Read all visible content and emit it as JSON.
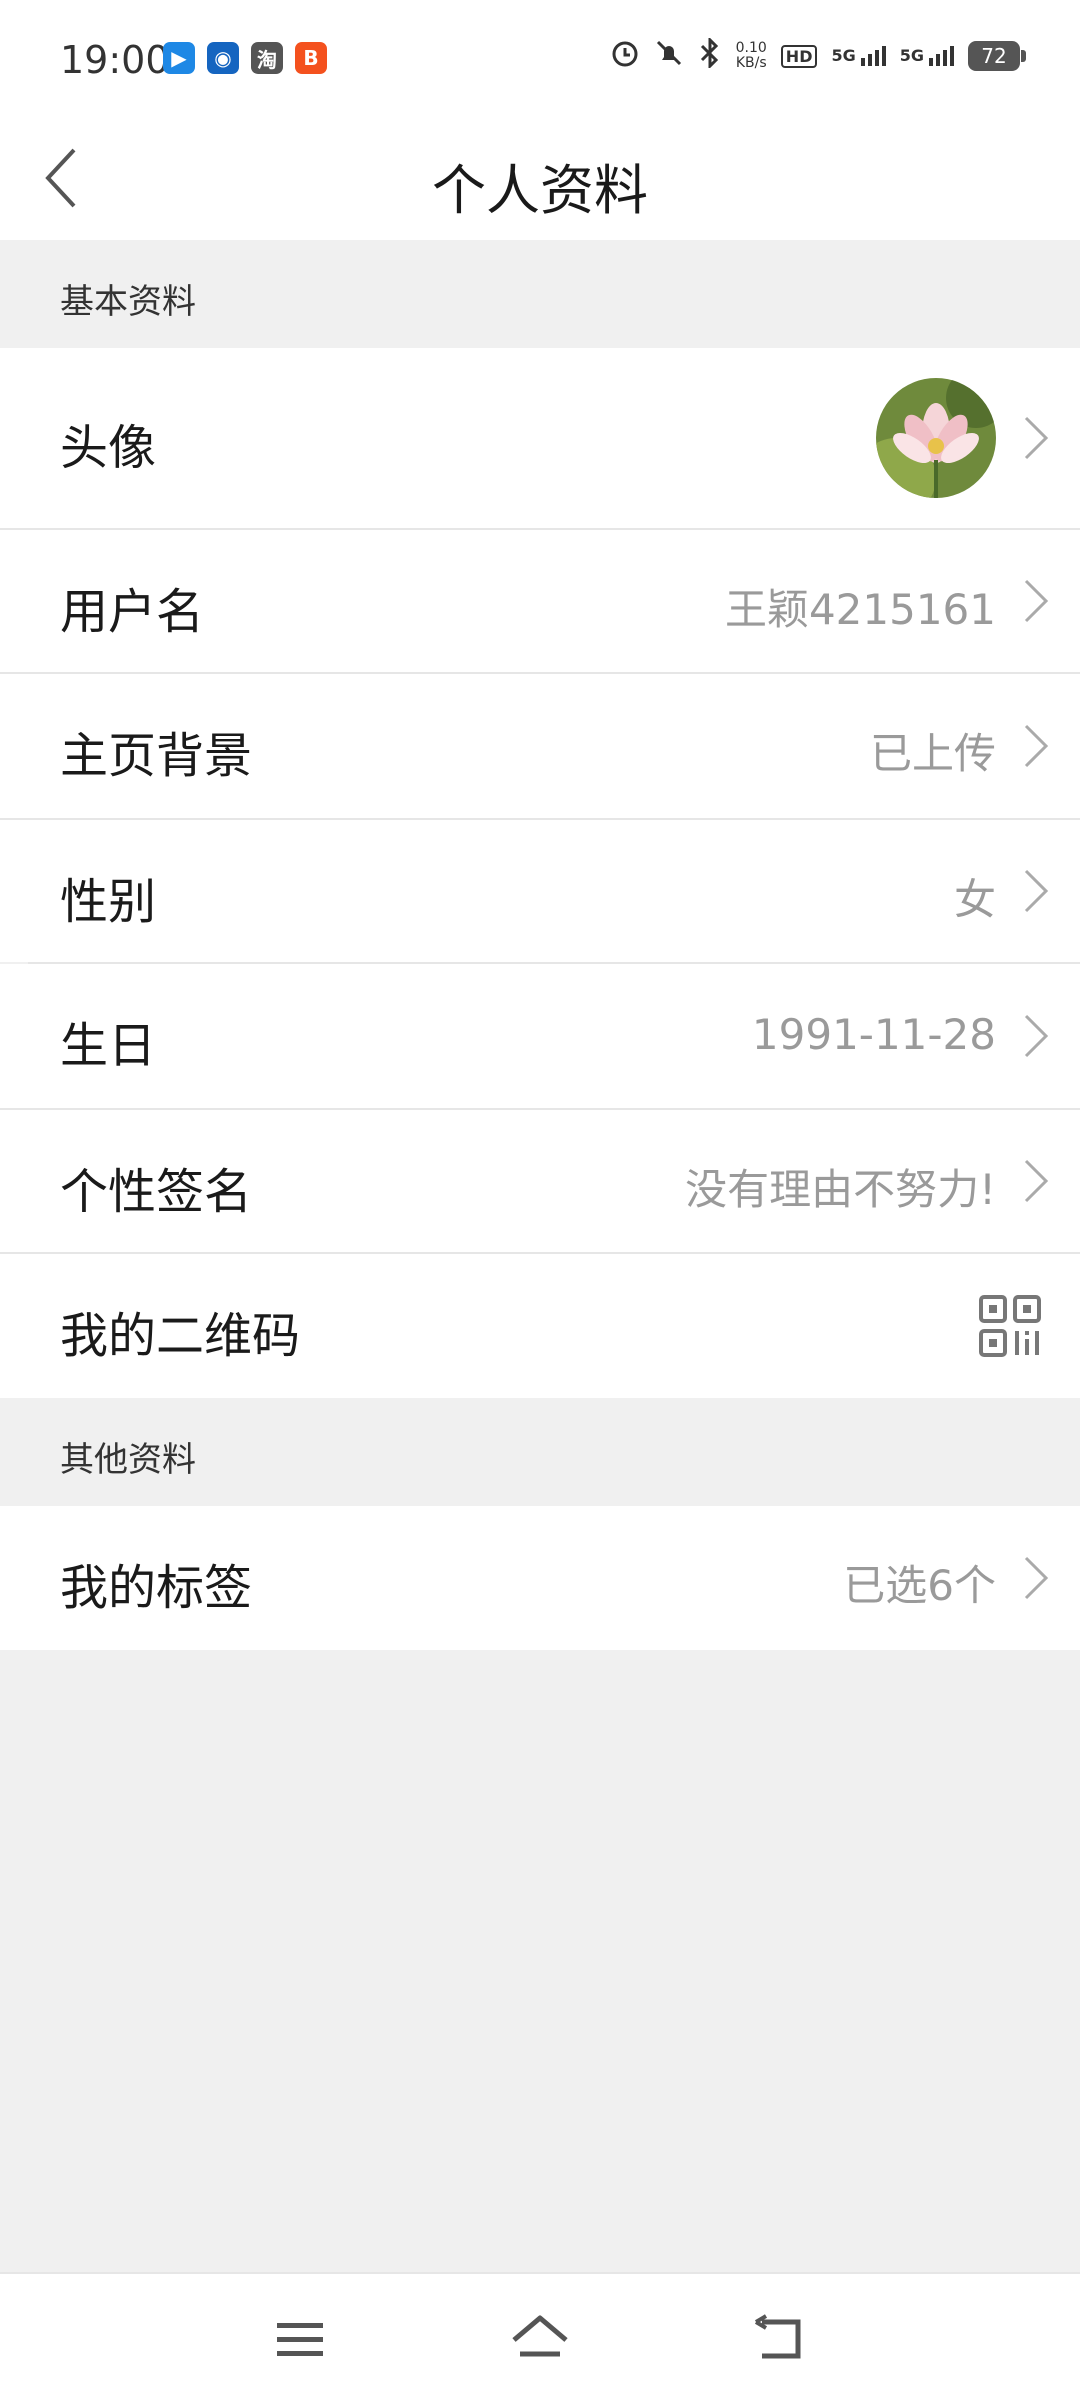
{
  "status_bar": {
    "time": "19:00",
    "apps": [
      {
        "icon": "play-app-icon",
        "glyph": "▶",
        "color": "#1e88e5"
      },
      {
        "icon": "robot-app-icon",
        "glyph": "◉",
        "color": "#1565c0"
      },
      {
        "icon": "taobao-app-icon",
        "glyph": "淘",
        "color": "#555555"
      },
      {
        "icon": "orange-app-icon",
        "glyph": "B",
        "color": "#f4511e"
      }
    ],
    "net_speed": "0.10",
    "net_unit": "KB/s",
    "hd_label": "HD",
    "signal1_label": "5G",
    "signal2_label": "5G",
    "battery": "72"
  },
  "header": {
    "title": "个人资料"
  },
  "sections": {
    "basic": "基本资料",
    "other": "其他资料"
  },
  "rows": {
    "avatar": {
      "label": "头像"
    },
    "username": {
      "label": "用户名",
      "value": "王颖4215161"
    },
    "background": {
      "label": "主页背景",
      "value": "已上传"
    },
    "gender": {
      "label": "性别",
      "value": "女"
    },
    "birthday": {
      "label": "生日",
      "value": "1991-11-28"
    },
    "signature": {
      "label": "个性签名",
      "value": "没有理由不努力!"
    },
    "qrcode": {
      "label": "我的二维码"
    },
    "tags": {
      "label": "我的标签",
      "value": "已选6个"
    }
  },
  "colors": {
    "background": "#f0f0f0",
    "value_text": "#9a9a9a",
    "primary_text": "#1a1a1a"
  }
}
